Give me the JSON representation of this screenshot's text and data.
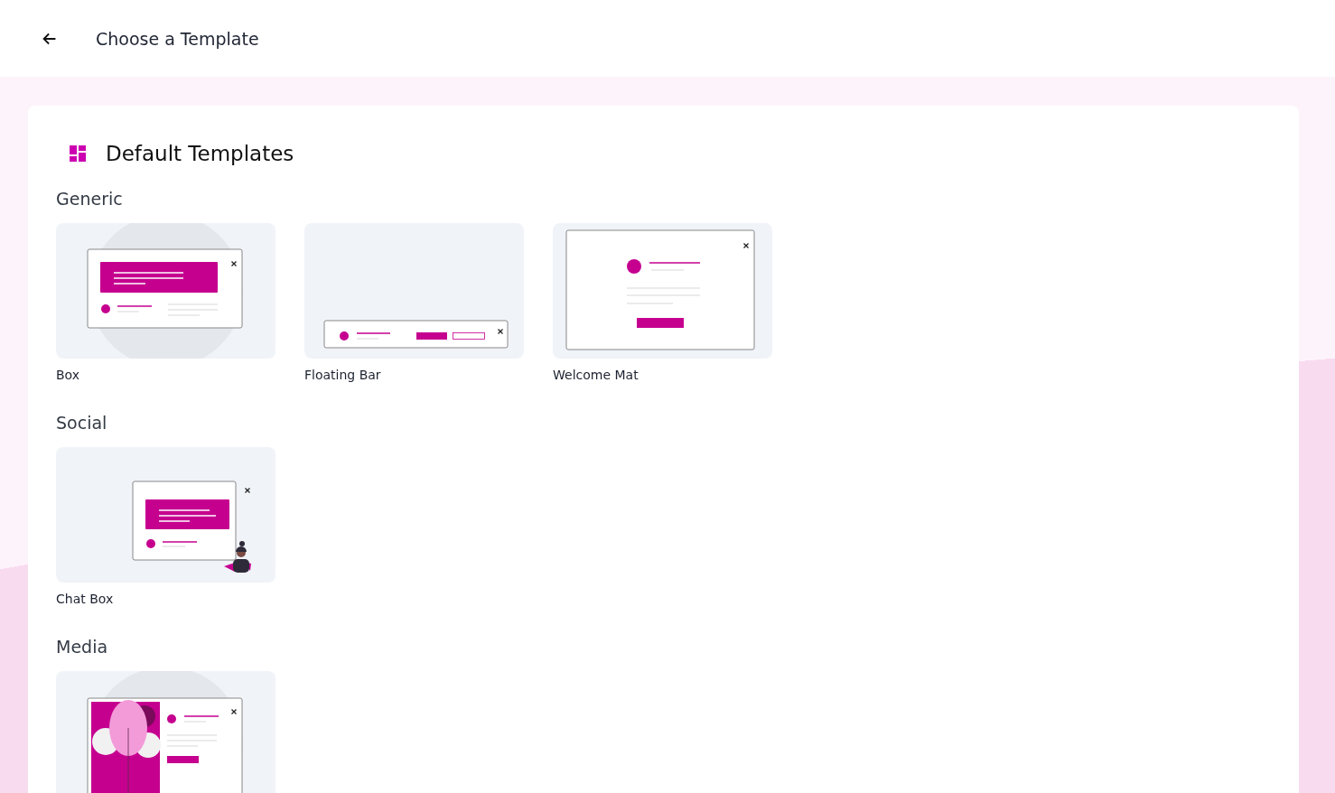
{
  "header": {
    "title": "Choose a Template"
  },
  "panel": {
    "title": "Default Templates",
    "sections": [
      {
        "title": "Generic",
        "templates": [
          {
            "name": "Box",
            "kind": "box"
          },
          {
            "name": "Floating Bar",
            "kind": "floating_bar"
          },
          {
            "name": "Welcome Mat",
            "kind": "welcome_mat"
          }
        ]
      },
      {
        "title": "Social",
        "templates": [
          {
            "name": "Chat Box",
            "kind": "chat_box"
          }
        ]
      },
      {
        "title": "Media",
        "templates": [
          {
            "kind": "media"
          }
        ]
      }
    ]
  }
}
